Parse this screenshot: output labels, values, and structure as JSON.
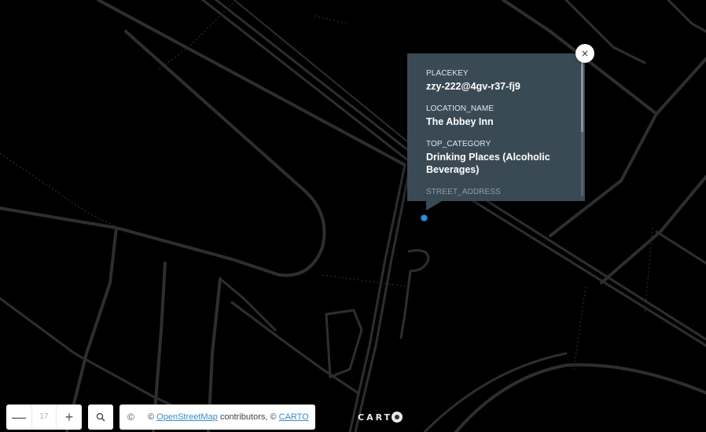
{
  "popup": {
    "fields": [
      {
        "label": "PLACEKEY",
        "value": "zzy-222@4gv-r37-fj9"
      },
      {
        "label": "LOCATION_NAME",
        "value": "The Abbey Inn"
      },
      {
        "label": "TOP_CATEGORY",
        "value": "Drinking Places (Alcoholic Beverages)"
      },
      {
        "label": "STREET_ADDRESS",
        "value": ""
      }
    ],
    "close_symbol": "×"
  },
  "zoom": {
    "minus_symbol": "—",
    "level": "17",
    "plus_symbol": "+"
  },
  "search": {
    "icon": "search-icon"
  },
  "attribution": {
    "toggle_symbol": "©",
    "prefix": "© ",
    "osm_link": "OpenStreetMap",
    "middle": " contributors, © ",
    "carto_link": "CARTO"
  },
  "logo": {
    "text": "CART"
  },
  "colors": {
    "map_background": "#000000",
    "road": "#2e2e2e",
    "popup_background": "#3a4a55",
    "poi_marker": "#2b8fd6",
    "link": "#3a8bc7"
  }
}
